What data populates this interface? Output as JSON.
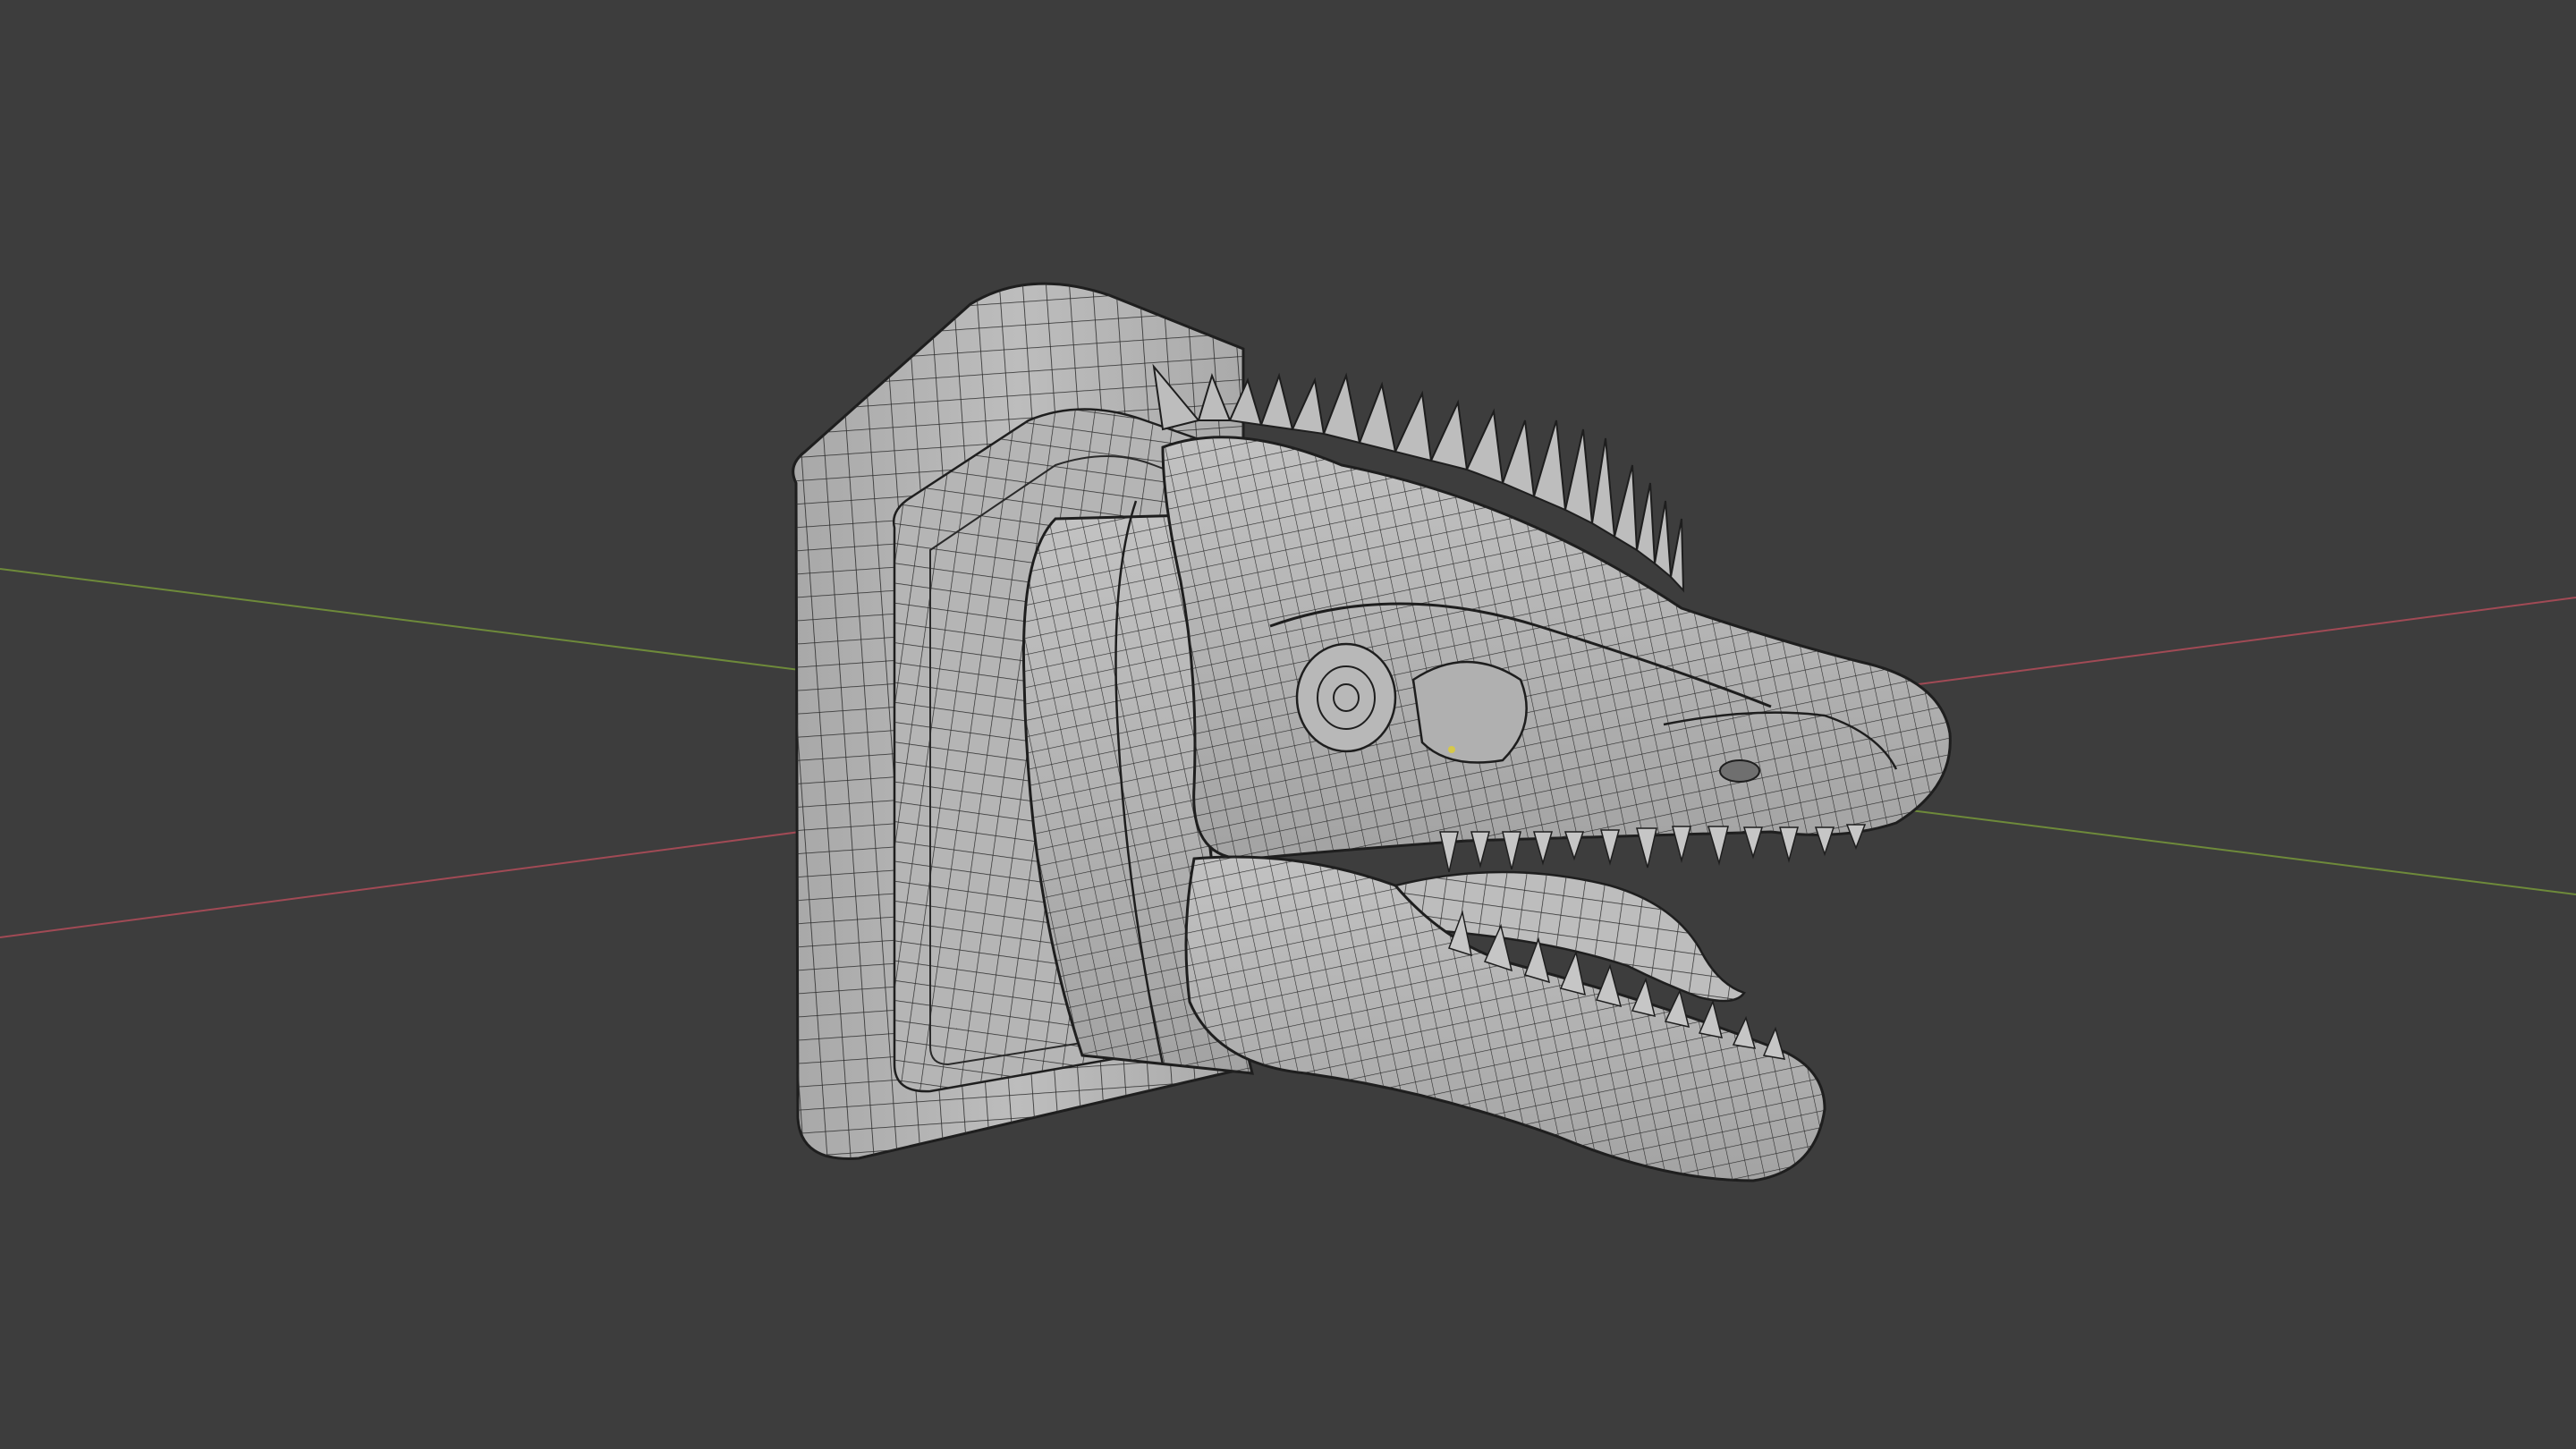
{
  "viewport": {
    "background": "#3d3d3d",
    "mesh_fill": "#b9b9b9",
    "mesh_shade": "#8f8f8f",
    "mesh_highlight": "#cfcfcf",
    "wire_color": "#2a2a2a",
    "axis_x_color": "#a14a55",
    "axis_y_color": "#6e8a3a",
    "origin_color": "#d6c84a"
  },
  "scene": {
    "object_icon": "wireframe-mesh",
    "object_description_visible": false
  }
}
